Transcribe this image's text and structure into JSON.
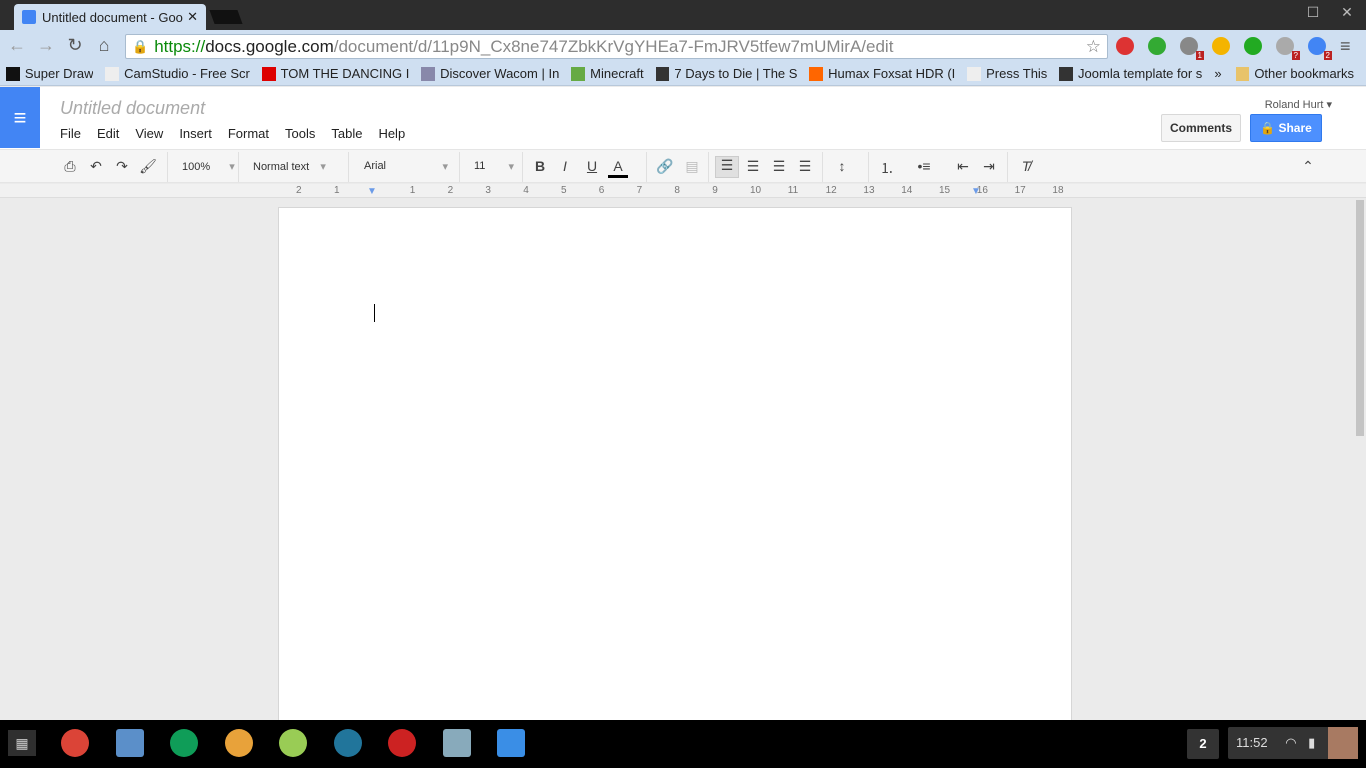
{
  "browser": {
    "tab_title": "Untitled document - Goo",
    "url_scheme": "https://",
    "url_host": "docs.google.com",
    "url_path": "/document/d/11p9N_Cx8ne747ZbkKrVgYHEa7-FmJRV5tfew7mUMirA/edit",
    "extensions": [
      {
        "icon": "adblock-icon",
        "color": "#d33"
      },
      {
        "icon": "evernote-icon",
        "color": "#3a3"
      },
      {
        "icon": "notification-bell-icon",
        "color": "#888",
        "badge": "1"
      },
      {
        "icon": "google-drive-icon",
        "color": "#f4b400"
      },
      {
        "icon": "id-icon",
        "color": "#2a2"
      },
      {
        "icon": "counter-icon",
        "color": "#aaa",
        "badge": "?"
      },
      {
        "icon": "google-icon",
        "color": "#4285f4",
        "badge": "2"
      }
    ]
  },
  "bookmarks": [
    {
      "label": "Super Draw",
      "color": "#111"
    },
    {
      "label": "CamStudio - Free Scr",
      "color": "#eee"
    },
    {
      "label": "TOM THE DANCING I",
      "color": "#d00"
    },
    {
      "label": "Discover Wacom | In",
      "color": "#88a"
    },
    {
      "label": "Minecraft",
      "color": "#6a4"
    },
    {
      "label": "7 Days to Die | The S",
      "color": "#333"
    },
    {
      "label": "Humax Foxsat HDR (I",
      "color": "#f60"
    },
    {
      "label": "Press This",
      "color": "#eee"
    },
    {
      "label": "Joomla template for s",
      "color": "#333"
    }
  ],
  "bookmarks_more": "»",
  "other_bookmarks": "Other bookmarks",
  "docs": {
    "title": "Untitled document",
    "menu": [
      "File",
      "Edit",
      "View",
      "Insert",
      "Format",
      "Tools",
      "Table",
      "Help"
    ],
    "user": "Roland Hurt ▾",
    "comments_label": "Comments",
    "share_label": "Share"
  },
  "toolbar": {
    "zoom": "100%",
    "style": "Normal text",
    "font": "Arial",
    "size": "11"
  },
  "ruler": [
    "2",
    "1",
    "1",
    "2",
    "3",
    "4",
    "5",
    "6",
    "7",
    "8",
    "9",
    "10",
    "11",
    "12",
    "13",
    "14",
    "15",
    "16",
    "17",
    "18"
  ],
  "shelf": {
    "workspace": "2",
    "time": "11:52",
    "apps": [
      {
        "icon": "chrome-icon",
        "color": "#db4437"
      },
      {
        "icon": "window-icon",
        "color": "#5b8fc9"
      },
      {
        "icon": "google-drive-icon",
        "color": "#0f9d58"
      },
      {
        "icon": "omg-chrome-icon",
        "color": "#e8a23a"
      },
      {
        "icon": "picasa-icon",
        "color": "#9c5"
      },
      {
        "icon": "wordpress-icon",
        "color": "#21759b"
      },
      {
        "icon": "youtube-icon",
        "color": "#c22"
      },
      {
        "icon": "cloud-icon",
        "color": "#8ab"
      },
      {
        "icon": "files-icon",
        "color": "#3a8ee6"
      }
    ]
  }
}
